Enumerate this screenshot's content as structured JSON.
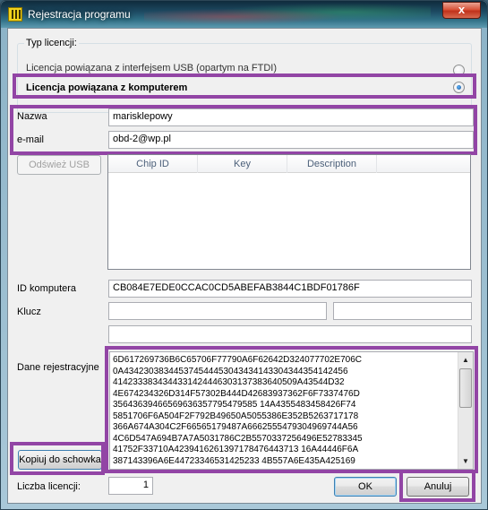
{
  "window": {
    "title": "Rejestracja programu",
    "close_label": "x"
  },
  "license_type": {
    "group_title": "Typ licencji:",
    "options": [
      {
        "label": "Licencja powiązana z interfejsem USB (opartym na FTDI)",
        "checked": false
      },
      {
        "label": "Licencja powiązana z komputerem",
        "checked": true
      }
    ]
  },
  "fields": {
    "name_label": "Nazwa",
    "name_value": "marisklepowy",
    "email_label": "e-mail",
    "email_value": "obd-2@wp.pl"
  },
  "usb": {
    "refresh_button": "Odśwież USB",
    "columns": [
      "Chip ID",
      "Key",
      "Description"
    ]
  },
  "computer": {
    "id_label": "ID komputera",
    "id_value": "CB084E7EDE0CCAC0CD5ABEFAB3844C1BDF01786F",
    "key_label": "Klucz",
    "key_values": [
      "",
      "",
      ""
    ]
  },
  "registration": {
    "label": "Dane rejestracyjne",
    "lines": [
      "6D617269736B6C65706F77790A6F62642D324077702E706C",
      "0A434230383445374544453043434143304344354142456",
      "4142333834344331424446303137383640509A43544D32",
      "4E674234326D314F57302B444D42683937362F6F7337476D",
      "35643639466569636357795479585 14A4355483458426F74",
      "5851706F6A504F2F792B49650A5055386E352B5263717178",
      "366A674A304C2F66565179487A6662555479304969744A56",
      "4C6D547A694B7A7A5031786C2B5570337256496E52783345",
      "41752F33710A4239416261397178476443713 16A44446F6A",
      "387143396A6E44723346531425233 4B557A6E435A425169"
    ],
    "copy_button": "Kopiuj do schowka"
  },
  "footer": {
    "count_label": "Liczba licencji:",
    "count_value": "1",
    "ok_button": "OK",
    "cancel_button": "Anuluj"
  },
  "colors": {
    "highlight": "#9245a5",
    "window_frame": "#8db4c8",
    "client_bg": "#f0f0f0"
  }
}
